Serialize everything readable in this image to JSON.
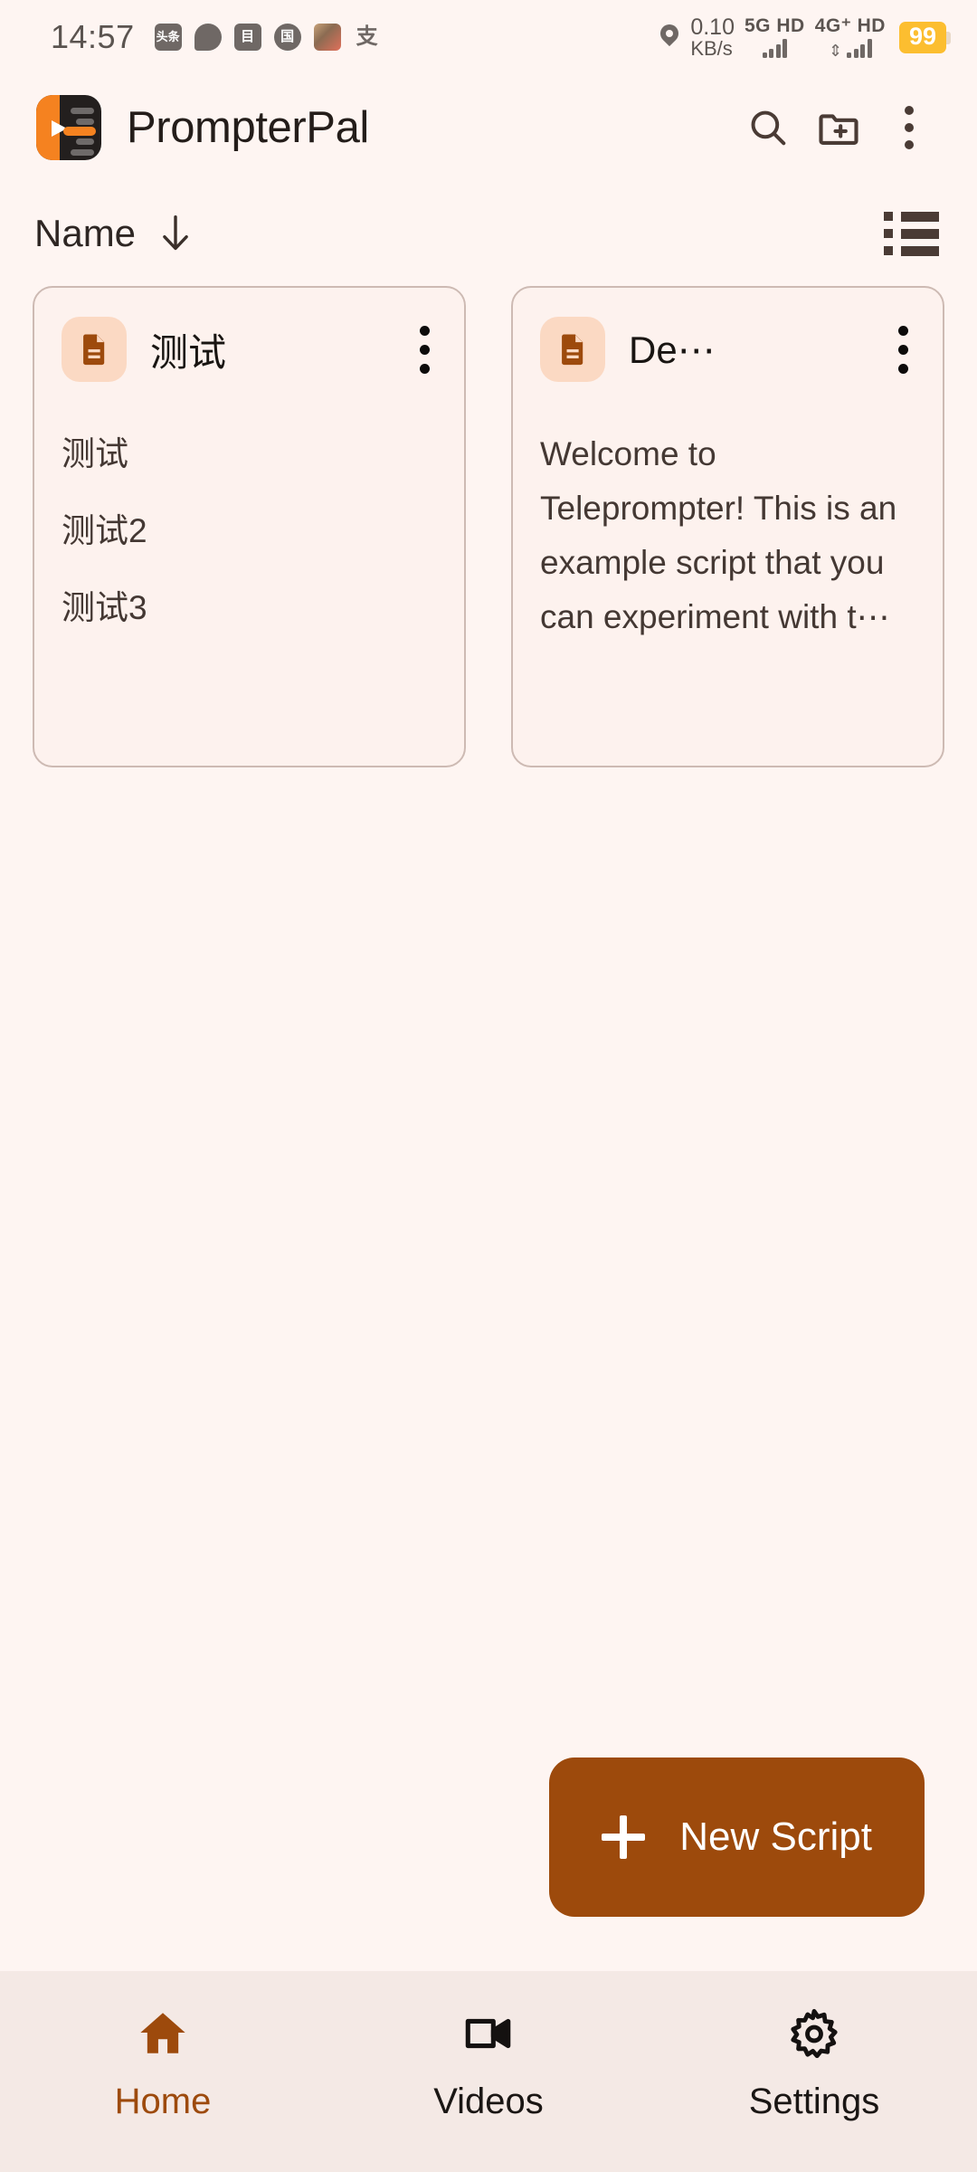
{
  "colors": {
    "page_bg": "#FEF5F2",
    "nav_bg": "#F4E9E5",
    "accent": "#9D4A0C",
    "logo_orange": "#F58220",
    "card_bg": "#FDF2EE",
    "card_border": "#CDBAB3",
    "doc_chip_bg": "#FBD9C3",
    "battery_yellow": "#FCBE30",
    "icon_brown": "#4A3B35"
  },
  "status_bar": {
    "time": "14:57",
    "notification_icons": [
      {
        "name": "toutiao-icon",
        "glyph": "头条"
      },
      {
        "name": "chat-bubble-icon",
        "glyph": ""
      },
      {
        "name": "wallet-icon",
        "glyph": "目"
      },
      {
        "name": "bank-icon",
        "glyph": "国"
      },
      {
        "name": "game-icon",
        "glyph": ""
      },
      {
        "name": "alipay-icon",
        "glyph": "支"
      }
    ],
    "location_icon": "location-pin-icon",
    "network_speed_value": "0.10",
    "network_speed_unit": "KB/s",
    "sim1_label": "5G HD",
    "sim2_label": "4G⁺ HD",
    "battery_percent": "99"
  },
  "app_bar": {
    "logo_name": "prompterpal-logo",
    "title": "PrompterPal",
    "actions": [
      {
        "name": "search-icon",
        "label": "Search"
      },
      {
        "name": "new-folder-icon",
        "label": "New Folder"
      },
      {
        "name": "overflow-menu-icon",
        "label": "More options"
      }
    ]
  },
  "sort_row": {
    "sort_label": "Name",
    "sort_direction_icon": "arrow-down-icon",
    "view_toggle_icon": "list-view-icon"
  },
  "cards": [
    {
      "icon": "document-icon",
      "title": "测试",
      "menu_icon": "card-overflow-icon",
      "body_lines": [
        "测试",
        "测试2",
        "测试3"
      ],
      "cjk": true
    },
    {
      "icon": "document-icon",
      "title": "De⋯",
      "menu_icon": "card-overflow-icon",
      "body_lines": [
        "Welcome to Teleprompter! This is an example script that you can experiment with t⋯"
      ],
      "cjk": false
    }
  ],
  "fab": {
    "icon": "plus-icon",
    "label": "New Script"
  },
  "bottom_nav": {
    "items": [
      {
        "name": "home",
        "label": "Home",
        "icon": "home-icon",
        "active": true
      },
      {
        "name": "videos",
        "label": "Videos",
        "icon": "video-camera-icon",
        "active": false
      },
      {
        "name": "settings",
        "label": "Settings",
        "icon": "gear-icon",
        "active": false
      }
    ]
  }
}
